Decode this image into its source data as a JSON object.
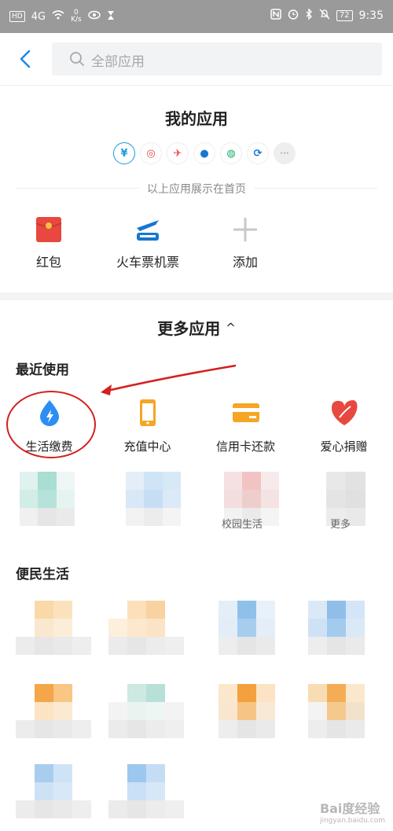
{
  "status_bar": {
    "hd": "HD",
    "signal": "4G",
    "speed_value": "0",
    "speed_unit": "K/s",
    "battery": "72",
    "time": "9:35"
  },
  "search": {
    "placeholder": "全部应用"
  },
  "my_apps": {
    "title": "我的应用",
    "mini_icons": [
      "¥",
      "◎",
      "✈",
      "●",
      "◍",
      "⟳",
      "···"
    ],
    "note": "以上应用展示在首页"
  },
  "pinned": [
    {
      "label": "红包",
      "icon": "red-envelope-icon"
    },
    {
      "label": "火车票机票",
      "icon": "train-plane-icon"
    },
    {
      "label": "添加",
      "icon": "plus-icon"
    }
  ],
  "more_apps": {
    "title": "更多应用",
    "chevron": "^"
  },
  "recent": {
    "title": "最近使用",
    "items": [
      {
        "label": "生活缴费",
        "icon": "lightning-drop-icon",
        "color": "#2c8ef2"
      },
      {
        "label": "充值中心",
        "icon": "phone-icon",
        "color": "#f5a623"
      },
      {
        "label": "信用卡还款",
        "icon": "card-icon",
        "color": "#f5a623"
      },
      {
        "label": "爱心捐赠",
        "icon": "heart-leaf-icon",
        "color": "#e8483f"
      }
    ],
    "partial_labels": [
      "校园生活",
      "更多"
    ]
  },
  "convenience": {
    "title": "便民生活"
  },
  "watermark": {
    "text": "Bai度经验",
    "sub": "jingyan.baidu.com"
  },
  "annotation_color": "#d51f1f"
}
